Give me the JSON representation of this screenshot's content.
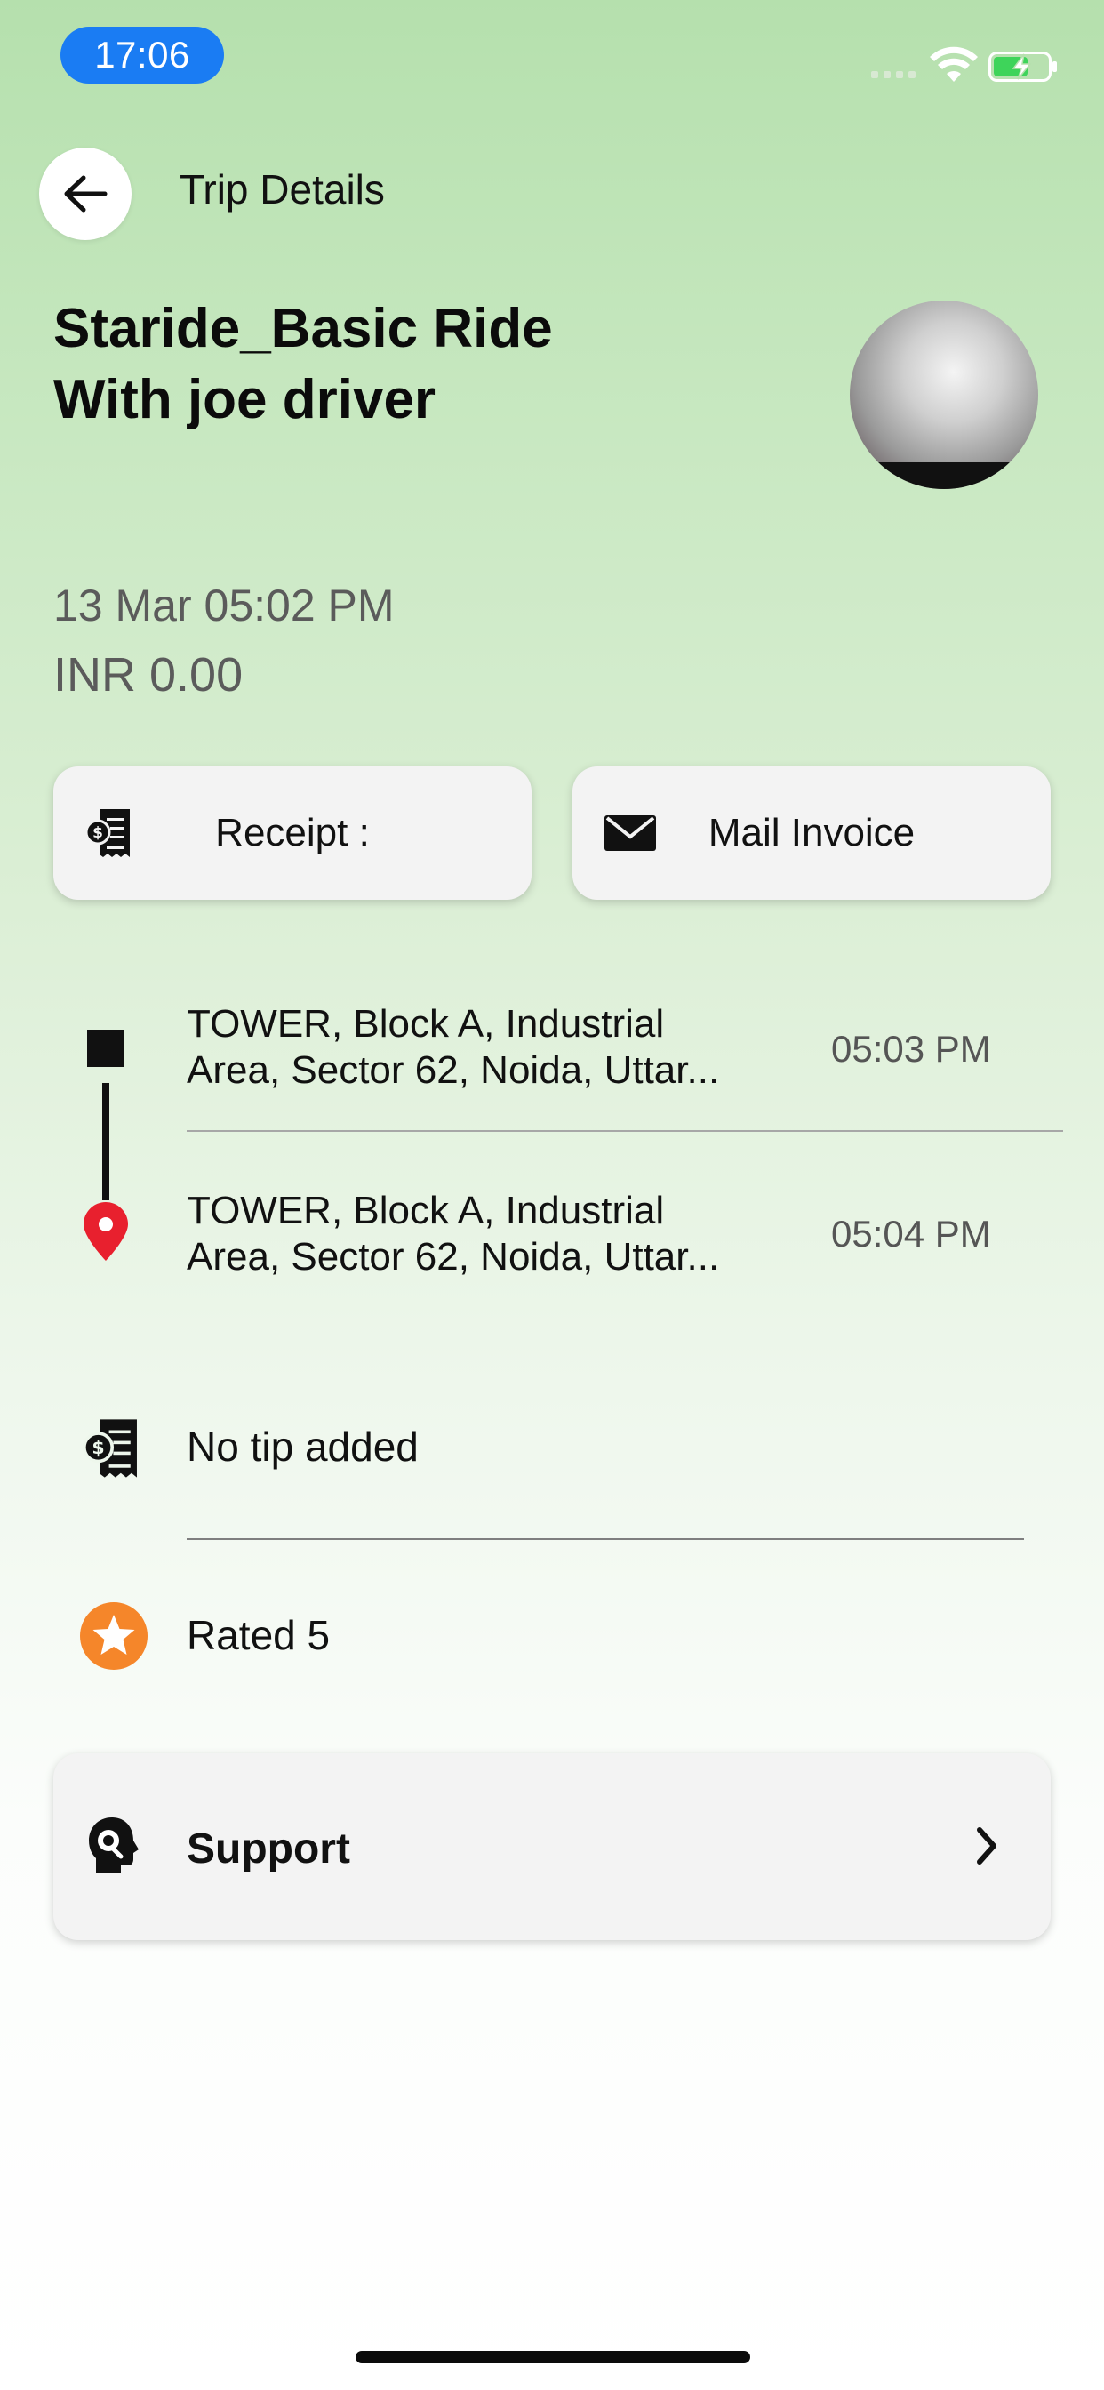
{
  "status_bar": {
    "time": "17:06",
    "icons": [
      "signal-icon",
      "wifi-icon",
      "battery-charging-icon"
    ],
    "pill_color": "#1a7cf3"
  },
  "header": {
    "title": "Trip Details",
    "back_icon": "arrow-left-icon"
  },
  "trip": {
    "title_line1": "Staride_Basic Ride",
    "title_line2": "With joe driver",
    "date": "13 Mar 05:02 PM",
    "amount": "INR 0.00"
  },
  "actions": {
    "receipt_label": "Receipt :",
    "receipt_icon": "receipt-icon",
    "mail_label": "Mail Invoice",
    "mail_icon": "envelope-icon"
  },
  "route": {
    "pickup": {
      "line1": "TOWER, Block A, Industrial",
      "line2": "Area, Sector 62, Noida, Uttar...",
      "time": "05:03 PM"
    },
    "dropoff": {
      "line1": "TOWER, Block A, Industrial",
      "line2": "Area, Sector 62, Noida, Uttar...",
      "time": "05:04 PM"
    },
    "pin_color": "#e8202e"
  },
  "tip": {
    "label": "No tip added",
    "icon": "receipt-icon"
  },
  "rating": {
    "label": "Rated 5",
    "icon": "star-icon",
    "color": "#f5862a"
  },
  "support": {
    "label": "Support",
    "icon": "support-agent-icon",
    "chevron": "chevron-right-icon"
  }
}
